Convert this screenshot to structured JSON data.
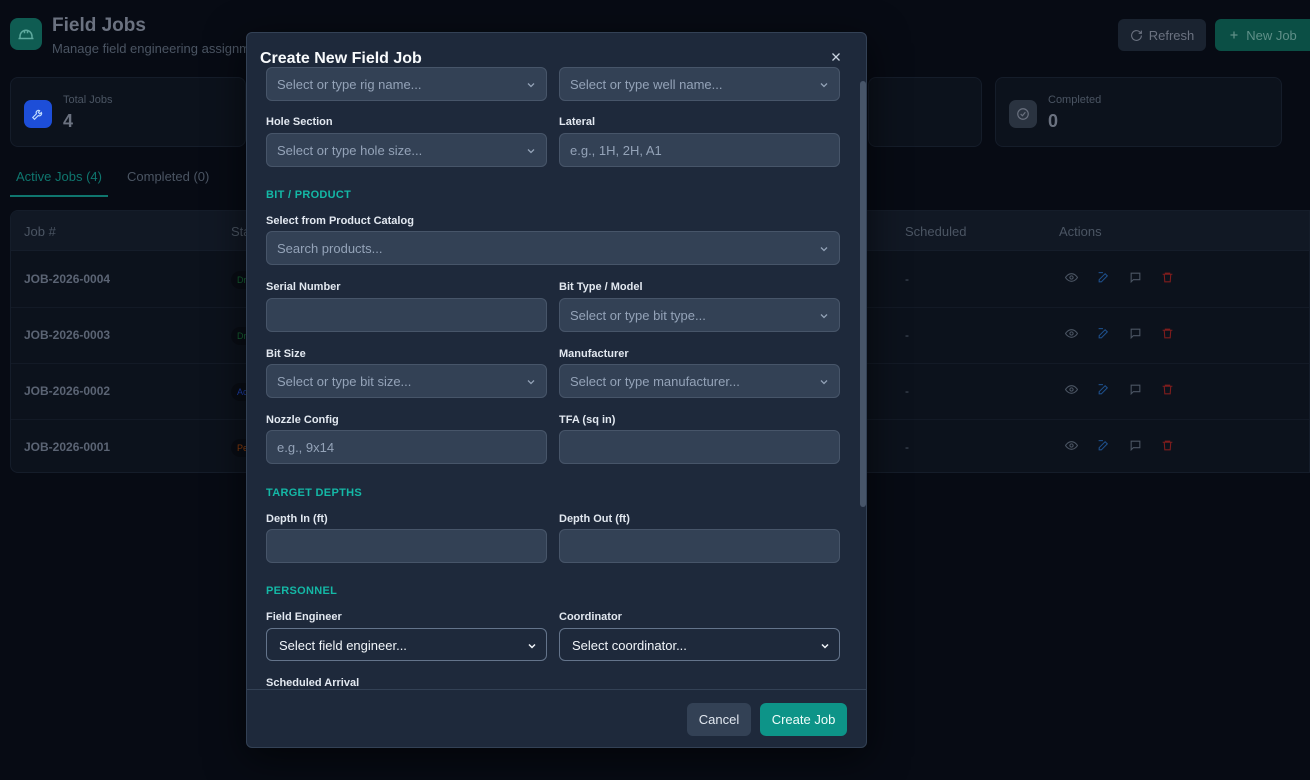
{
  "page": {
    "title": "Field Jobs",
    "subtitle": "Manage field engineering assignm",
    "refresh_label": "Refresh",
    "new_job_label": "New Job"
  },
  "stats": [
    {
      "label": "Total Jobs",
      "value": "4",
      "icon": "wrench-icon",
      "color": "#1d4ed8"
    },
    {
      "label": "Completed",
      "value": "0",
      "icon": "check-circle-icon",
      "color": "#374151"
    }
  ],
  "tabs": [
    {
      "label": "Active Jobs (4)",
      "active": true
    },
    {
      "label": "Completed (0)",
      "active": false
    }
  ],
  "table": {
    "headers": {
      "job": "Job #",
      "status": "Sta",
      "scheduled": "Scheduled",
      "actions": "Actions"
    },
    "rows": [
      {
        "job": "JOB-2026-0004",
        "status": "Dr",
        "status_color": "#166534",
        "scheduled": "-"
      },
      {
        "job": "JOB-2026-0003",
        "status": "Dr",
        "status_color": "#166534",
        "scheduled": "-"
      },
      {
        "job": "JOB-2026-0002",
        "status": "Ac",
        "status_color": "#1e40af",
        "scheduled": "-"
      },
      {
        "job": "JOB-2026-0001",
        "status": "Pe",
        "status_color": "#92400e",
        "scheduled": "-"
      }
    ]
  },
  "modal": {
    "title": "Create New Field Job",
    "fields": {
      "rig_placeholder": "Select or type rig name...",
      "well_placeholder": "Select or type well name...",
      "hole_section_label": "Hole Section",
      "hole_section_placeholder": "Select or type hole size...",
      "lateral_label": "Lateral",
      "lateral_placeholder": "e.g., 1H, 2H, A1",
      "section_bit": "BIT / PRODUCT",
      "catalog_label": "Select from Product Catalog",
      "catalog_placeholder": "Search products...",
      "serial_label": "Serial Number",
      "serial_value": "",
      "bit_type_label": "Bit Type / Model",
      "bit_type_placeholder": "Select or type bit type...",
      "bit_size_label": "Bit Size",
      "bit_size_placeholder": "Select or type bit size...",
      "manufacturer_label": "Manufacturer",
      "manufacturer_placeholder": "Select or type manufacturer...",
      "nozzle_label": "Nozzle Config",
      "nozzle_placeholder": "e.g., 9x14",
      "tfa_label": "TFA (sq in)",
      "tfa_value": "",
      "section_depths": "TARGET DEPTHS",
      "depth_in_label": "Depth In (ft)",
      "depth_in_value": "",
      "depth_out_label": "Depth Out (ft)",
      "depth_out_value": "",
      "section_personnel": "PERSONNEL",
      "engineer_label": "Field Engineer",
      "engineer_value": "Select field engineer...",
      "coordinator_label": "Coordinator",
      "coordinator_value": "Select coordinator...",
      "arrival_label": "Scheduled Arrival"
    },
    "cancel_label": "Cancel",
    "create_label": "Create Job"
  },
  "colors": {
    "accent": "#0d9488",
    "section": "#14b8a6",
    "danger": "#b91c1c"
  }
}
